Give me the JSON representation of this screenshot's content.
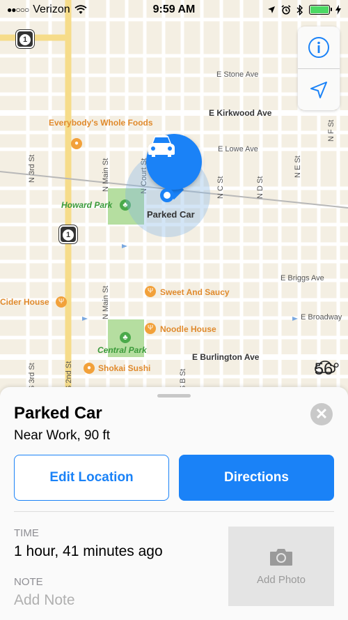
{
  "status_bar": {
    "carrier": "Verizon",
    "time": "9:59 AM",
    "signal_dots": "●●○○○"
  },
  "map": {
    "streets": {
      "stone": "E Stone Ave",
      "kirkwood": "E Kirkwood Ave",
      "lowe": "E Lowe Ave",
      "briggs": "E Briggs Ave",
      "broadway": "E Broadway",
      "burlington": "E Burlington Ave",
      "n3rd": "N 3rd St",
      "nmain1": "N Main St",
      "ncourt": "N Court St",
      "nc": "N C St",
      "nd": "N D St",
      "ne": "N E St",
      "nf": "N F St",
      "nmain2": "N Main St",
      "s3rd": "S 3rd St",
      "s2nd": "S 2nd St",
      "sb": "S B St"
    },
    "pois": {
      "wholefoods": "Everybody's Whole Foods",
      "howard_park": "Howard Park",
      "sweet": "Sweet And Saucy",
      "cider": "Cider House",
      "noodle": "Noodle House",
      "central_park": "Central Park",
      "shokai": "Shokai Sushi"
    },
    "highway_number": "1",
    "pin_label": "Parked Car",
    "weather_temp": "56°"
  },
  "sheet": {
    "title": "Parked Car",
    "subtitle": "Near Work, 90 ft",
    "edit_button": "Edit Location",
    "directions_button": "Directions",
    "time_label": "TIME",
    "time_value": "1 hour, 41 minutes ago",
    "note_label": "NOTE",
    "note_placeholder": "Add Note",
    "add_photo": "Add Photo"
  },
  "colors": {
    "accent": "#1a82f7",
    "map_bg": "#f4efe3",
    "park": "#b5dea0",
    "poi": "#f2a13a"
  },
  "icons": {
    "wifi": "wifi-icon",
    "location": "location-arrow-icon",
    "alarm": "alarm-icon",
    "bluetooth": "bluetooth-icon",
    "battery": "battery-icon",
    "charging": "charging-icon",
    "info": "info-icon",
    "tracking": "location-tracking-icon",
    "car": "car-icon",
    "cloud": "cloud-icon",
    "camera": "camera-icon",
    "close": "close-icon"
  }
}
